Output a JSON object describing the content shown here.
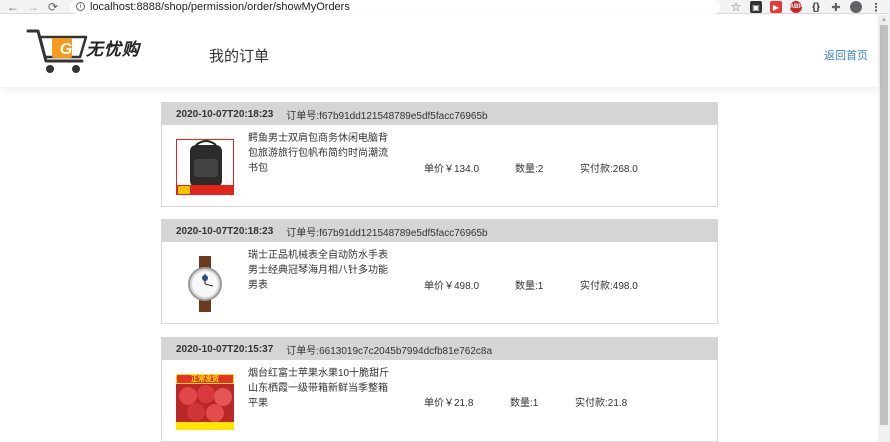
{
  "browser": {
    "back_glyph": "←",
    "forward_glyph": "→",
    "reload_glyph": "⟳",
    "url": "localhost:8888/shop/permission/order/showMyOrders",
    "extensions": [
      "star-icon",
      "ext-icon",
      "youtube-icon",
      "abp-icon",
      "json-icon",
      "puzzle-icon",
      "profile-icon",
      "menu-icon"
    ]
  },
  "header": {
    "logo_letter": "G",
    "brand": "无忧购",
    "title": "我的订单",
    "home_link": "返回首页"
  },
  "labels": {
    "order_no_prefix": "订单号:",
    "unit_price_prefix": "单价￥",
    "quantity_prefix": "数量:",
    "paid_prefix": "实付款:"
  },
  "orders": [
    {
      "time": "2020-10-07T20:18:23",
      "order_no": "订单号:f67b91dd121548789e5df5facc76965b",
      "product": "鳄鱼男士双肩包商务休闲电脑背包旅游旅行包帆布简约时尚潮流书包",
      "price": "单价￥134.0",
      "quantity": "数量:2",
      "paid": "实付款:268.0",
      "thumb": "backpack-image"
    },
    {
      "time": "2020-10-07T20:18:23",
      "order_no": "订单号:f67b91dd121548789e5df5facc76965b",
      "product": "瑞士正品机械表全自动防水手表男士经典冠琴海月相八针多功能男表",
      "price": "单价￥498.0",
      "quantity": "数量:1",
      "paid": "实付款:498.0",
      "thumb": "watch-image"
    },
    {
      "time": "2020-10-07T20:15:37",
      "order_no": "订单号:6613019c7c2045b7994dcfb81e762c8a",
      "product": "烟台红富士苹果水果10十脆甜斤山东栖霞一级带箱新鲜当季整箱平果",
      "price": "单价￥21.8",
      "quantity": "数量:1",
      "paid": "实付款:21.8",
      "thumb": "apples-image",
      "thumb_text": "正常发货"
    }
  ]
}
